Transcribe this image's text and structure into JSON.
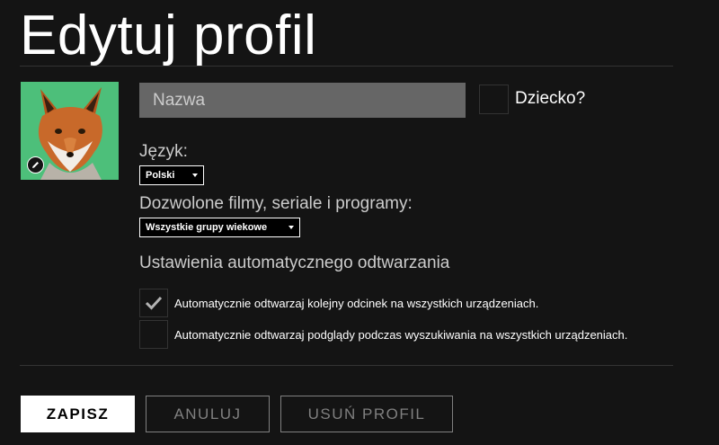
{
  "page": {
    "title": "Edytuj profil"
  },
  "profile": {
    "name_placeholder": "Nazwa",
    "kid_label": "Dziecko?",
    "kid_checked": false
  },
  "language": {
    "label": "Język:",
    "selected": "Polski"
  },
  "maturity": {
    "label": "Dozwolone filmy, seriale i programy:",
    "selected": "Wszystkie grupy wiekowe"
  },
  "autoplay": {
    "heading": "Ustawienia automatycznego odtwarzania",
    "options": [
      {
        "label": "Automatycznie odtwarzaj kolejny odcinek na wszystkich urządzeniach.",
        "checked": true
      },
      {
        "label": "Automatycznie odtwarzaj podglądy podczas wyszukiwania na wszystkich urządzeniach.",
        "checked": false
      }
    ]
  },
  "buttons": {
    "save": "ZAPISZ",
    "cancel": "ANULUJ",
    "delete": "USUŃ PROFIL"
  },
  "colors": {
    "background": "#141414",
    "input_bg": "#666666",
    "muted_text": "#cccccc",
    "button_outline": "#808080"
  },
  "icons": {
    "avatar": "fox-avatar",
    "edit": "pencil-icon",
    "check": "check-icon",
    "dropdown": "caret-down-icon"
  }
}
